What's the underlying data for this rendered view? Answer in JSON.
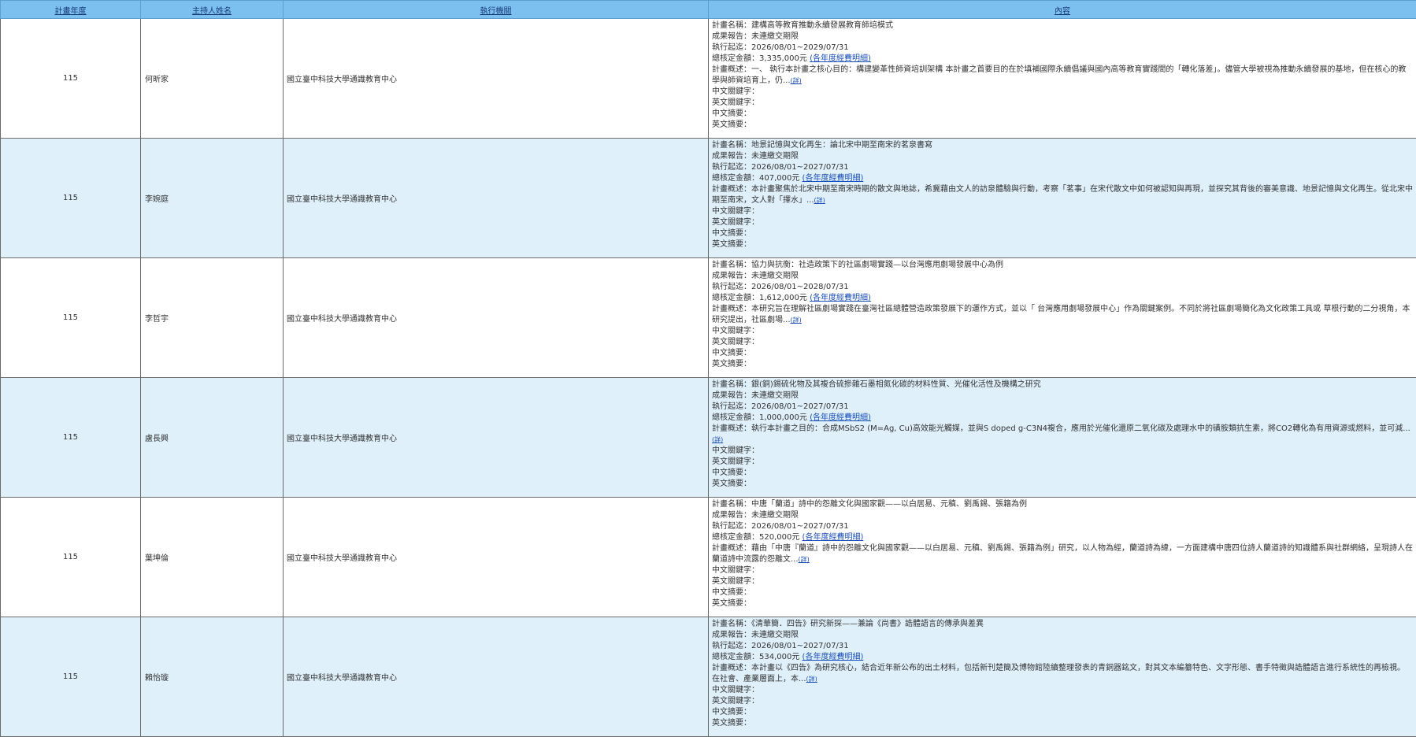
{
  "headers": {
    "year": "計畫年度",
    "pi": "主持人姓名",
    "agency": "執行機關",
    "content": "內容"
  },
  "labels": {
    "plan_name": "計畫名稱：",
    "report": "成果報告：",
    "period": "執行起迄：",
    "amount": "總核定金額：",
    "amount_link": "(各年度經費明細)",
    "summary": "計畫概述：",
    "more": "(詳)",
    "kw_zh": "中文關鍵字：",
    "kw_en": "英文關鍵字：",
    "abs_zh": "中文摘要：",
    "abs_en": "英文摘要："
  },
  "rows": [
    {
      "year": "115",
      "pi": "何昕家",
      "agency": "國立臺中科技大學通識教育中心",
      "plan_name": "建構高等教育推動永續發展教育師培模式",
      "report": "未連繳交期限",
      "period": "2026/08/01~2029/07/31",
      "amount": "3,335,000元",
      "summary": "一、 執行本計畫之核心目的：構建變革性師資培訓架構 本計畫之首要目的在於填補國際永續倡議與國內高等教育實踐間的「轉化落差」。儘管大學被視為推動永續發展的基地，但在核心的教學與師資培育上，仍..."
    },
    {
      "year": "115",
      "pi": "李婉庭",
      "agency": "國立臺中科技大學通識教育中心",
      "plan_name": "地景記憶與文化再生：論北宋中期至南宋的茗泉書寫",
      "report": "未連繳交期限",
      "period": "2026/08/01~2027/07/31",
      "amount": "407,000元",
      "summary": "本計畫聚焦於北宋中期至南宋時期的散文與地誌，希冀藉由文人的訪泉體驗與行動，考察「茗事」在宋代散文中如何被認知與再現，並探究其背後的審美意識、地景記憶與文化再生。從北宋中期至南宋，文人對「擇水」..."
    },
    {
      "year": "115",
      "pi": "李哲宇",
      "agency": "國立臺中科技大學通識教育中心",
      "plan_name": "協力與抗衡：社造政策下的社區劇場實踐—以台灣應用劇場發展中心為例",
      "report": "未連繳交期限",
      "period": "2026/08/01~2028/07/31",
      "amount": "1,612,000元",
      "summary": "本研究旨在理解社區劇場實踐在臺灣社區總體營造政策發展下的運作方式，並以「 台灣應用劇場發展中心」作為關鍵案例。不同於將社區劇場簡化為文化政策工具或 草根行動的二分視角，本研究提出，社區劇場..."
    },
    {
      "year": "115",
      "pi": "盧長興",
      "agency": "國立臺中科技大學通識教育中心",
      "plan_name": "銀(銅)錫硫化物及其複合硫摻雜石墨相氮化碳的材料性質、光催化活性及機構之研究",
      "report": "未連繳交期限",
      "period": "2026/08/01~2027/07/31",
      "amount": "1,000,000元",
      "summary": "執行本計畫之目的：合成MSbS2 (M=Ag, Cu)高效能光觸媒，並與S doped g-C3N4複合，應用於光催化還原二氧化碳及處理水中的磺胺類抗生素，將CO2轉化為有用資源或燃料，並可減..."
    },
    {
      "year": "115",
      "pi": "葉坤倫",
      "agency": "國立臺中科技大學通識教育中心",
      "plan_name": "中唐「蘭道」詩中的怨離文化與國家觀——以白居易、元稹、劉禹錫、張籍為例",
      "report": "未連繳交期限",
      "period": "2026/08/01~2027/07/31",
      "amount": "520,000元",
      "summary": "藉由「中唐『蘭道』詩中的怨離文化與國家觀——以白居易、元稹、劉禹錫、張籍為例」研究，以人物為經，蘭道詩為緯，一方面建構中唐四位詩人蘭道詩的知識體系與社群網絡，呈現詩人在蘭道詩中流露的怨離文..."
    },
    {
      "year": "115",
      "pi": "賴怡璇",
      "agency": "國立臺中科技大學通識教育中心",
      "plan_name": "《清華簡．四告》研究新探——兼論《尚書》誥體語言的傳承與差異",
      "report": "未連繳交期限",
      "period": "2026/08/01~2027/07/31",
      "amount": "534,000元",
      "summary": "本計畫以《四告》為研究核心，結合近年新公布的出土材料，包括新刊楚簡及博物館陸續整理發表的青銅器銘文，對其文本編纂特色、文字形態、書手特徵與誥體語言進行系統性的再檢視。 在社會、產業層面上，本..."
    }
  ]
}
